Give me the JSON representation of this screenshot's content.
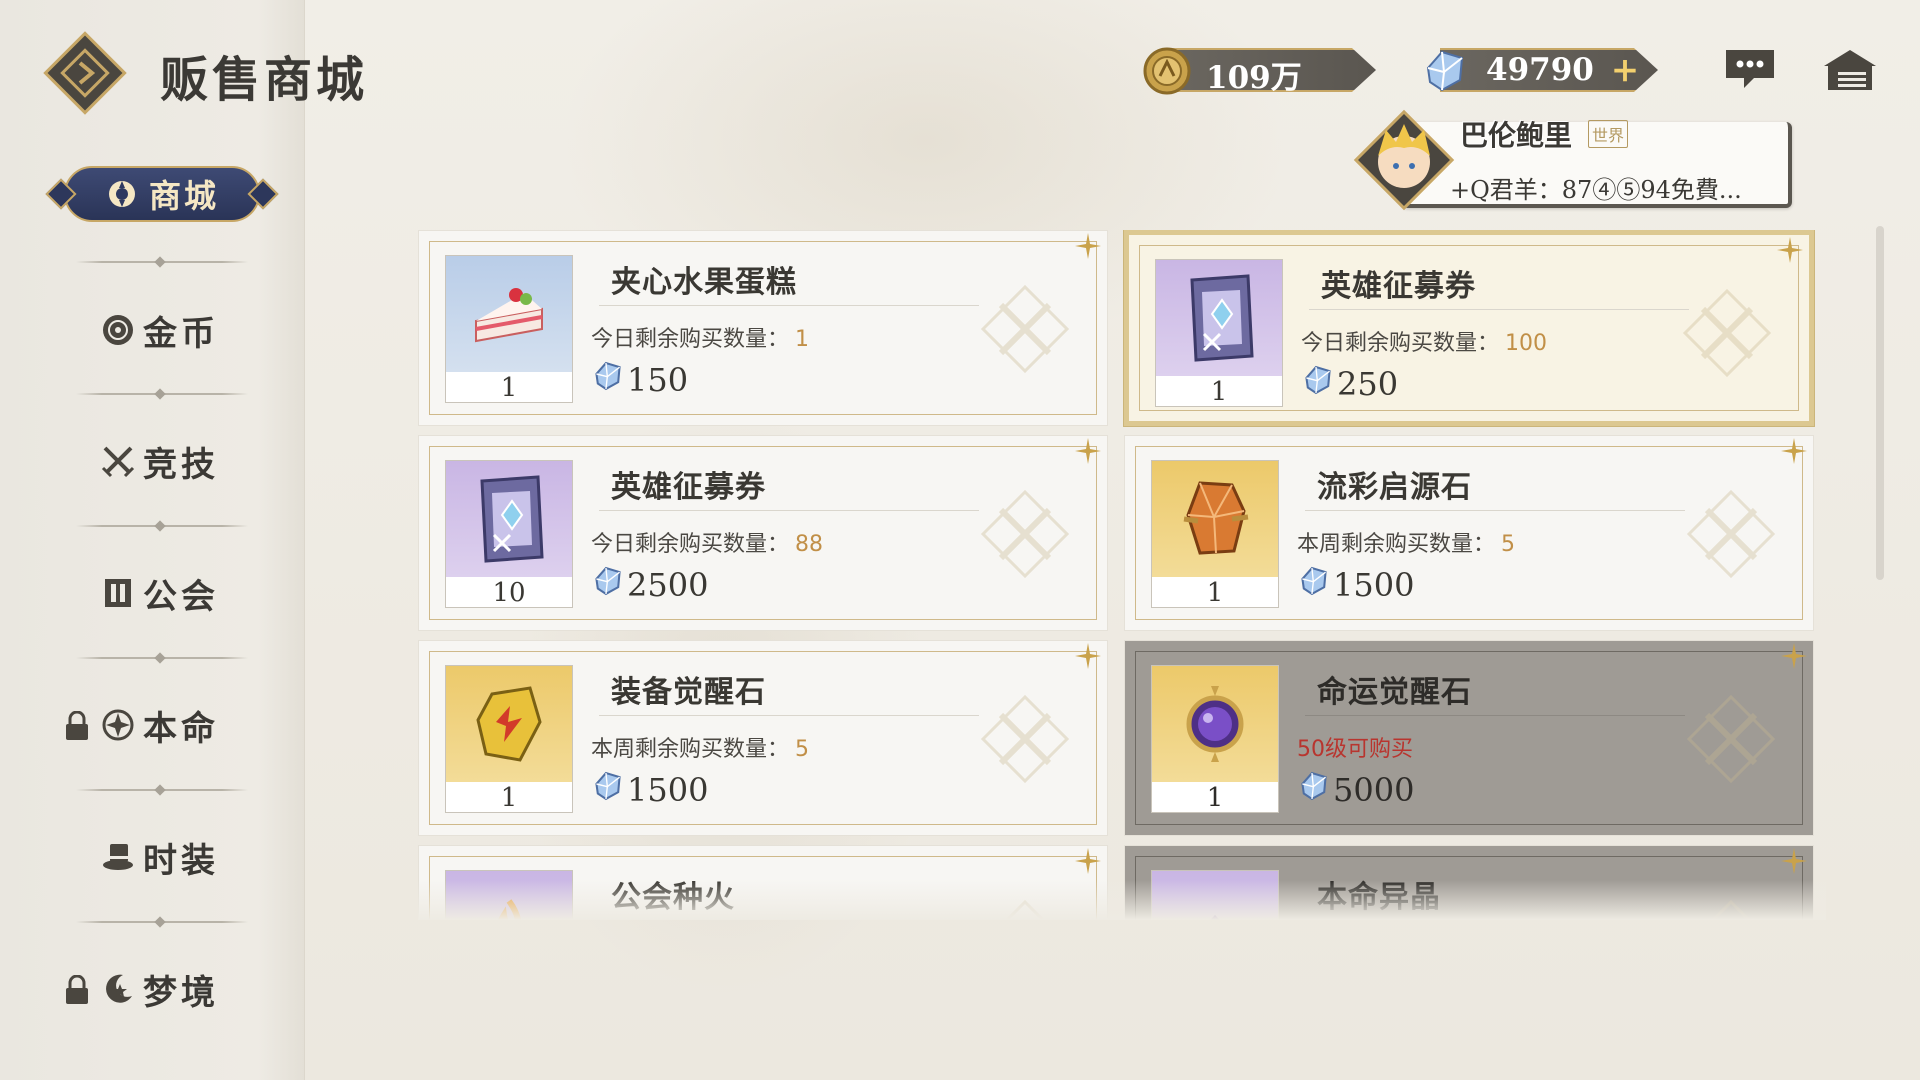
{
  "header": {
    "title": "贩售商城",
    "logo_icon": "compass-diamond-icon"
  },
  "currencies": [
    {
      "icon": "gold-coin-icon",
      "value": "109万"
    },
    {
      "icon": "crystal-gem-icon",
      "value": "49790"
    }
  ],
  "top_icons": [
    "chat-bubble-icon",
    "mailbox-icon"
  ],
  "chat": {
    "name": "巴伦鲍里",
    "channel_tag": "世界",
    "message": "+Q君羊：87④⑤94免費..."
  },
  "sidebar": {
    "active_tab": "商城",
    "items": [
      {
        "label": "金币",
        "icon": "coin-flower-icon",
        "locked": false
      },
      {
        "label": "竞技",
        "icon": "crossed-swords-icon",
        "locked": false
      },
      {
        "label": "公会",
        "icon": "guild-shield-icon",
        "locked": false
      },
      {
        "label": "本命",
        "icon": "fate-emblem-icon",
        "locked": true
      },
      {
        "label": "时装",
        "icon": "top-hat-icon",
        "locked": false
      },
      {
        "label": "梦境",
        "icon": "moon-star-icon",
        "locked": true
      }
    ]
  },
  "items": [
    {
      "title": "夹心水果蛋糕",
      "limit_label": "今日剩余购买数量：",
      "limit_value": "1",
      "price": "150",
      "count": "1",
      "art": "cake",
      "bg": "blue",
      "state": "normal"
    },
    {
      "title": "英雄征募券",
      "limit_label": "今日剩余购买数量：",
      "limit_value": "100",
      "price": "250",
      "count": "1",
      "art": "ticket",
      "bg": "purple",
      "state": "selected"
    },
    {
      "title": "英雄征募券",
      "limit_label": "今日剩余购买数量：",
      "limit_value": "88",
      "price": "2500",
      "count": "10",
      "art": "ticket",
      "bg": "purple",
      "state": "normal"
    },
    {
      "title": "流彩启源石",
      "limit_label": "本周剩余购买数量：",
      "limit_value": "5",
      "price": "1500",
      "count": "1",
      "art": "orange-stone",
      "bg": "gold",
      "state": "normal"
    },
    {
      "title": "装备觉醒石",
      "limit_label": "本周剩余购买数量：",
      "limit_value": "5",
      "price": "1500",
      "count": "1",
      "art": "yellow-stone",
      "bg": "gold",
      "state": "normal"
    },
    {
      "title": "命运觉醒石",
      "limit_label": "50级可购买",
      "limit_value": "",
      "price": "5000",
      "count": "1",
      "art": "purple-orb",
      "bg": "gold",
      "state": "locked"
    },
    {
      "title": "公会种火",
      "limit_label": "",
      "limit_value": "",
      "price": "",
      "count": "",
      "art": "flame",
      "bg": "purple",
      "state": "normal"
    },
    {
      "title": "本命异晶",
      "limit_label": "",
      "limit_value": "",
      "price": "",
      "count": "",
      "art": "purple-crystal",
      "bg": "purple",
      "state": "locked"
    }
  ],
  "colors": {
    "accent_gold": "#c7a766",
    "tab_navy": "#2a3457",
    "limit_number": "#c18f47",
    "warning_red": "#b8352f"
  }
}
